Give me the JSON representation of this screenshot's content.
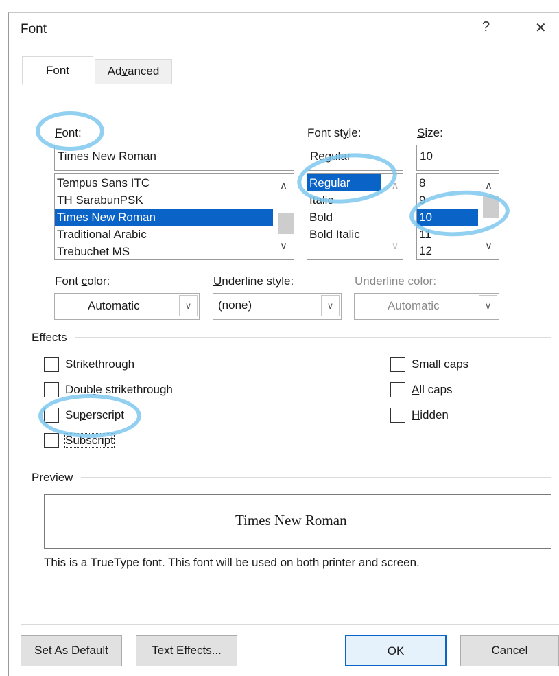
{
  "window": {
    "title": "Font",
    "help_glyph": "?",
    "close_glyph": "✕"
  },
  "tabs": [
    {
      "label_pre": "Fo",
      "label_ul": "n",
      "label_post": "t"
    },
    {
      "label_pre": "Ad",
      "label_ul": "v",
      "label_post": "anced"
    }
  ],
  "font": {
    "label_ul": "F",
    "label_post": "ont:",
    "value": "Times New Roman",
    "items": [
      "Tempus Sans ITC",
      "TH SarabunPSK",
      "Times New Roman",
      "Traditional Arabic",
      "Trebuchet MS"
    ],
    "selected": "Times New Roman"
  },
  "font_style": {
    "label_pre": "Font st",
    "label_ul": "y",
    "label_post": "le:",
    "value": "Regular",
    "items": [
      "Regular",
      "Italic",
      "Bold",
      "Bold Italic"
    ],
    "selected": "Regular"
  },
  "size": {
    "label_ul": "S",
    "label_post": "ize:",
    "value": "10",
    "items": [
      "8",
      "9",
      "10",
      "11",
      "12"
    ],
    "selected": "10"
  },
  "font_color": {
    "label_pre": "Font ",
    "label_ul": "c",
    "label_post": "olor:",
    "value": "Automatic"
  },
  "underline_style": {
    "label_ul": "U",
    "label_post": "nderline style:",
    "value": "(none)"
  },
  "underline_color": {
    "label": "Underline color:",
    "value": "Automatic"
  },
  "effects": {
    "title": "Effects",
    "left": [
      {
        "pre": "Stri",
        "ul": "k",
        "post": "ethrough",
        "checked": false
      },
      {
        "pre": "Doub",
        "ul": "l",
        "post": "e strikethrough",
        "checked": false
      },
      {
        "pre": "Su",
        "ul": "p",
        "post": "erscript",
        "checked": false
      },
      {
        "pre": "Su",
        "ul": "b",
        "post": "script",
        "checked": false
      }
    ],
    "right": [
      {
        "pre": "S",
        "ul": "m",
        "post": "all caps",
        "checked": false
      },
      {
        "pre": "",
        "ul": "A",
        "post": "ll caps",
        "checked": false
      },
      {
        "pre": "",
        "ul": "H",
        "post": "idden",
        "checked": false
      }
    ]
  },
  "preview": {
    "title": "Preview",
    "sample": "Times New Roman",
    "note": "This is a TrueType font. This font will be used on both printer and screen."
  },
  "buttons": {
    "set_default": {
      "pre": "Set As ",
      "ul": "D",
      "post": "efault"
    },
    "text_effects": {
      "pre": "Text ",
      "ul": "E",
      "post": "ffects..."
    },
    "ok": "OK",
    "cancel": "Cancel"
  },
  "colors": {
    "selection": "#0a64c8",
    "annotation": "#7ec8ef"
  }
}
